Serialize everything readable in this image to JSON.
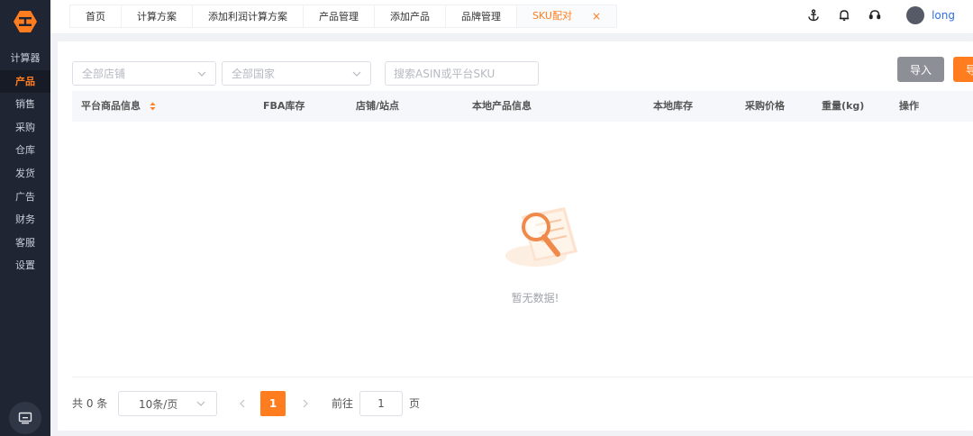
{
  "sidebar": {
    "items": [
      {
        "label": "计算器",
        "active": false
      },
      {
        "label": "产品",
        "active": true
      },
      {
        "label": "销售",
        "active": false
      },
      {
        "label": "采购",
        "active": false
      },
      {
        "label": "仓库",
        "active": false
      },
      {
        "label": "发货",
        "active": false
      },
      {
        "label": "广告",
        "active": false
      },
      {
        "label": "财务",
        "active": false
      },
      {
        "label": "客服",
        "active": false
      },
      {
        "label": "设置",
        "active": false
      }
    ]
  },
  "tabs": [
    {
      "label": "首页"
    },
    {
      "label": "计算方案"
    },
    {
      "label": "添加利润计算方案"
    },
    {
      "label": "产品管理"
    },
    {
      "label": "添加产品"
    },
    {
      "label": "品牌管理"
    },
    {
      "label": "SKU配对",
      "active": true
    }
  ],
  "header": {
    "close_glyph": "×",
    "username": "long",
    "icons": [
      "anchor-icon",
      "bell-icon",
      "headset-icon"
    ]
  },
  "filters": {
    "shop_placeholder": "全部店铺",
    "country_placeholder": "全部国家",
    "search_placeholder": "搜索ASIN或平台SKU"
  },
  "actions": {
    "import_label": "导入",
    "export_label": "导"
  },
  "table": {
    "columns": [
      "平台商品信息",
      "FBA库存",
      "店铺/站点",
      "本地产品信息",
      "本地库存",
      "采购价格",
      "重量(kg)",
      "操作"
    ]
  },
  "empty": {
    "text": "暂无数据!"
  },
  "pagination": {
    "total_text": "共 0 条",
    "page_size": "10条/页",
    "current_page": "1",
    "goto_label": "前往",
    "goto_value": "1",
    "page_suffix": "页"
  },
  "colors": {
    "accent": "#ff7d1f",
    "sidebar_bg": "#1f2533",
    "button_gray": "#8c8f95"
  }
}
